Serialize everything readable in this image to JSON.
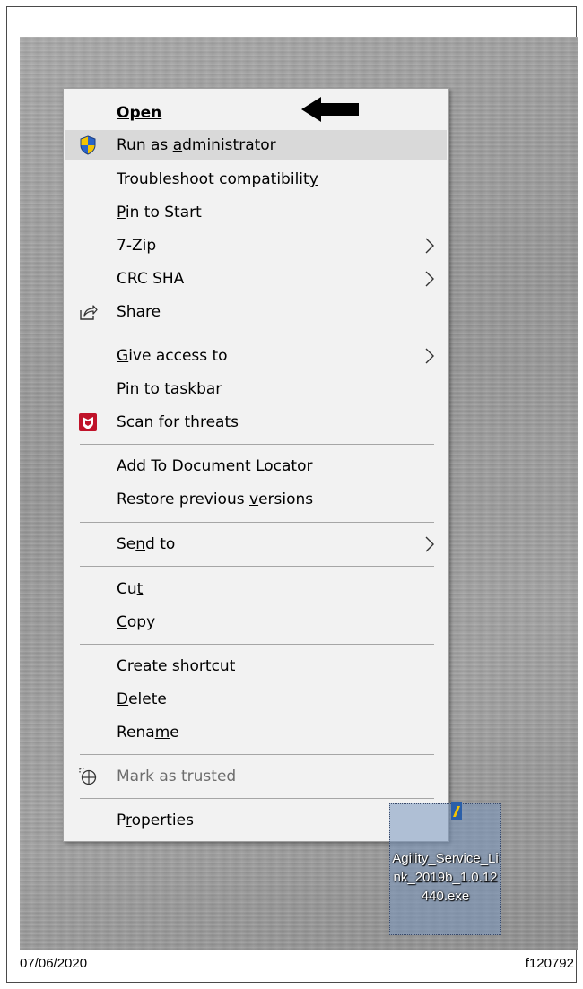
{
  "menu": {
    "items": [
      {
        "id": "open",
        "label": "Open"
      },
      {
        "id": "run-as-admin",
        "label_pre": "Run as ",
        "label_u": "a",
        "label_post": "dministrator"
      },
      {
        "id": "troubleshoot",
        "label_pre": "Troubleshoot compatibilit",
        "label_u": "y",
        "label_post": ""
      },
      {
        "id": "pin-start",
        "label_pre": "",
        "label_u": "P",
        "label_post": "in to Start"
      },
      {
        "id": "7zip",
        "label": "7-Zip"
      },
      {
        "id": "crc-sha",
        "label": "CRC SHA"
      },
      {
        "id": "share",
        "label": "Share"
      },
      {
        "id": "give-access",
        "label_pre": "",
        "label_u": "G",
        "label_post": "ive access to"
      },
      {
        "id": "pin-taskbar",
        "label_pre": "Pin to tas",
        "label_u": "k",
        "label_post": "bar"
      },
      {
        "id": "scan",
        "label": "Scan for threats"
      },
      {
        "id": "add-doc-locator",
        "label": "Add To Document Locator"
      },
      {
        "id": "restore",
        "label_pre": "Restore previous ",
        "label_u": "v",
        "label_post": "ersions"
      },
      {
        "id": "send-to",
        "label_pre": "Se",
        "label_u": "n",
        "label_post": "d to"
      },
      {
        "id": "cut",
        "label_pre": "Cu",
        "label_u": "t",
        "label_post": ""
      },
      {
        "id": "copy",
        "label_pre": "",
        "label_u": "C",
        "label_post": "opy"
      },
      {
        "id": "create-shortcut",
        "label_pre": "Create ",
        "label_u": "s",
        "label_post": "hortcut"
      },
      {
        "id": "delete",
        "label_pre": "",
        "label_u": "D",
        "label_post": "elete"
      },
      {
        "id": "rename",
        "label_pre": "Rena",
        "label_u": "m",
        "label_post": "e"
      },
      {
        "id": "mark-trusted",
        "label": "Mark as trusted"
      },
      {
        "id": "properties",
        "label_pre": "P",
        "label_u": "r",
        "label_post": "operties"
      }
    ]
  },
  "desktop_icon": {
    "name": "Agility_Service_Link_2019b_1.0.12440.exe",
    "icon": "exe-file-icon"
  },
  "colors": {
    "menu_bg": "#f2f2f2",
    "highlight": "#d9d9d9",
    "shield_blue": "#2a64c8",
    "shield_yellow": "#f5c400",
    "mcafee_red": "#c0132a"
  },
  "footer": {
    "date": "07/06/2020",
    "figure_id": "f120792"
  }
}
